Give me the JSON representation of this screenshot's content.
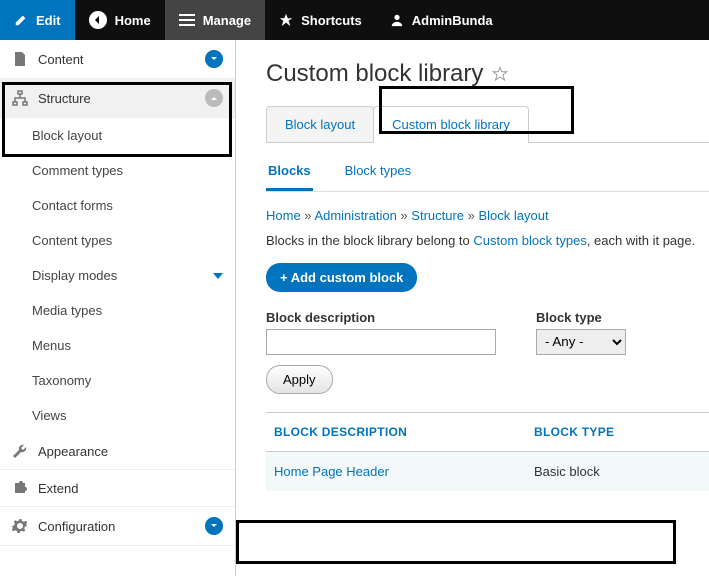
{
  "toolbar": {
    "edit": "Edit",
    "home": "Home",
    "manage": "Manage",
    "shortcuts": "Shortcuts",
    "user": "AdminBunda"
  },
  "sidebar": {
    "content": "Content",
    "structure": "Structure",
    "structure_items": [
      "Block layout",
      "Comment types",
      "Contact forms",
      "Content types",
      "Display modes",
      "Media types",
      "Menus",
      "Taxonomy",
      "Views"
    ],
    "appearance": "Appearance",
    "extend": "Extend",
    "configuration": "Configuration"
  },
  "page": {
    "title": "Custom block library",
    "tabs": [
      "Block layout",
      "Custom block library"
    ],
    "subtabs": [
      "Blocks",
      "Block types"
    ],
    "crumbs": [
      "Home",
      "Administration",
      "Structure",
      "Block layout"
    ],
    "desc_pre": "Blocks in the block library belong to ",
    "desc_link": "Custom block types",
    "desc_post": ", each with it page.",
    "add_btn": "+ Add custom block",
    "filter_desc_label": "Block description",
    "filter_type_label": "Block type",
    "type_any": "- Any -",
    "apply": "Apply",
    "th_desc": "BLOCK DESCRIPTION",
    "th_type": "BLOCK TYPE",
    "row": {
      "desc": "Home Page Header",
      "type": "Basic block"
    }
  }
}
